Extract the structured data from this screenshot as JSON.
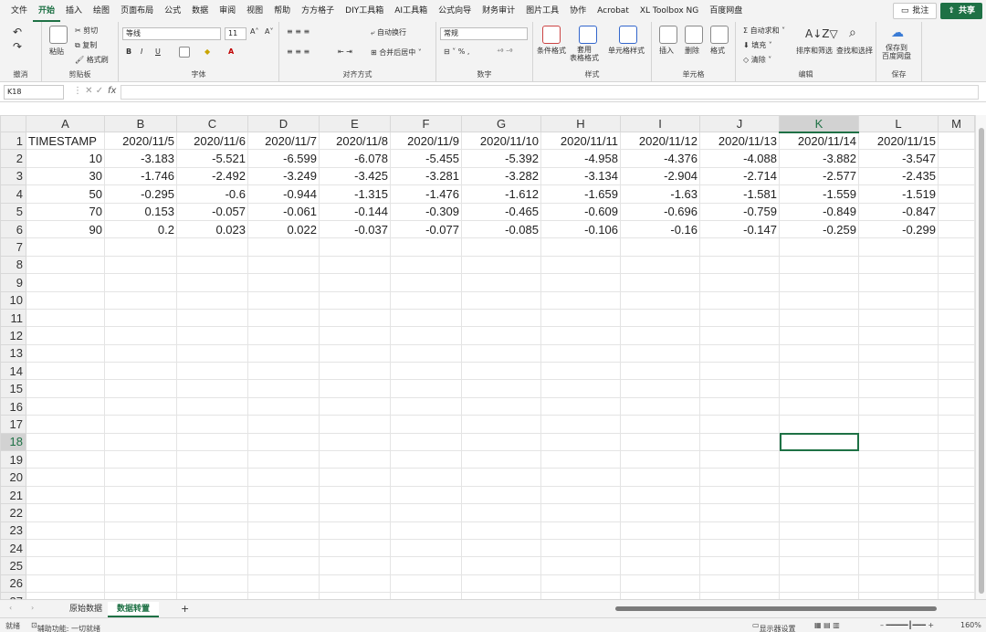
{
  "menu": {
    "tabs": [
      "文件",
      "开始",
      "插入",
      "绘图",
      "页面布局",
      "公式",
      "数据",
      "审阅",
      "视图",
      "帮助",
      "方方格子",
      "DIY工具箱",
      "AI工具箱",
      "公式向导",
      "财务审计",
      "图片工具",
      "协作",
      "Acrobat",
      "XL Toolbox NG",
      "百度网盘"
    ],
    "active_tab": "开始",
    "comment_label": "批注",
    "share_label": "共享"
  },
  "ribbon": {
    "undo_group": "撤消",
    "clipboard": {
      "paste": "粘贴",
      "cut": "剪切",
      "copy": "复制",
      "format_painter": "格式刷",
      "label": "剪贴板"
    },
    "font": {
      "name": "等线",
      "size": "11",
      "label": "字体",
      "bold": "B",
      "italic": "I",
      "underline": "U"
    },
    "alignment": {
      "wrap": "自动换行",
      "merge": "合并后居中",
      "label": "对齐方式"
    },
    "number": {
      "format": "常规",
      "label": "数字"
    },
    "styles": {
      "conditional": "条件格式",
      "table": "套用\n表格格式",
      "cell_styles": "单元格样式",
      "label": "样式"
    },
    "cells": {
      "insert": "插入",
      "delete": "删除",
      "format": "格式",
      "label": "单元格"
    },
    "editing": {
      "autosum": "自动求和",
      "fill": "填充",
      "clear": "清除",
      "sort": "排序和筛选",
      "find": "查找和选择",
      "label": "编辑"
    },
    "save": {
      "save_baidu": "保存到\n百度网盘",
      "label": "保存"
    }
  },
  "formula_bar": {
    "name_box": "K18",
    "fx": "fx",
    "value": ""
  },
  "grid": {
    "columns": [
      "A",
      "B",
      "C",
      "D",
      "E",
      "F",
      "G",
      "H",
      "I",
      "J",
      "K",
      "L",
      "M"
    ],
    "selected_column": "K",
    "selected_row": 18,
    "row_count": 27,
    "rows": [
      [
        "TIMESTAMP",
        "2020/11/5",
        "2020/11/6",
        "2020/11/7",
        "2020/11/8",
        "2020/11/9",
        "2020/11/10",
        "2020/11/11",
        "2020/11/12",
        "2020/11/13",
        "2020/11/14",
        "2020/11/15"
      ],
      [
        "10",
        "-3.183",
        "-5.521",
        "-6.599",
        "-6.078",
        "-5.455",
        "-5.392",
        "-4.958",
        "-4.376",
        "-4.088",
        "-3.882",
        "-3.547"
      ],
      [
        "30",
        "-1.746",
        "-2.492",
        "-3.249",
        "-3.425",
        "-3.281",
        "-3.282",
        "-3.134",
        "-2.904",
        "-2.714",
        "-2.577",
        "-2.435"
      ],
      [
        "50",
        "-0.295",
        "-0.6",
        "-0.944",
        "-1.315",
        "-1.476",
        "-1.612",
        "-1.659",
        "-1.63",
        "-1.581",
        "-1.559",
        "-1.519"
      ],
      [
        "70",
        "0.153",
        "-0.057",
        "-0.061",
        "-0.144",
        "-0.309",
        "-0.465",
        "-0.609",
        "-0.696",
        "-0.759",
        "-0.849",
        "-0.847"
      ],
      [
        "90",
        "0.2",
        "0.023",
        "0.022",
        "-0.037",
        "-0.077",
        "-0.085",
        "-0.106",
        "-0.16",
        "-0.147",
        "-0.259",
        "-0.299"
      ]
    ]
  },
  "sheets": {
    "tabs": [
      "原始数据",
      "数据转置"
    ],
    "active": "数据转置",
    "add": "+"
  },
  "status": {
    "ready": "就绪",
    "accessibility": "辅助功能: 一切就绪",
    "display_settings": "显示器设置",
    "zoom": "160%"
  },
  "colors": {
    "accent": "#1e7145"
  }
}
